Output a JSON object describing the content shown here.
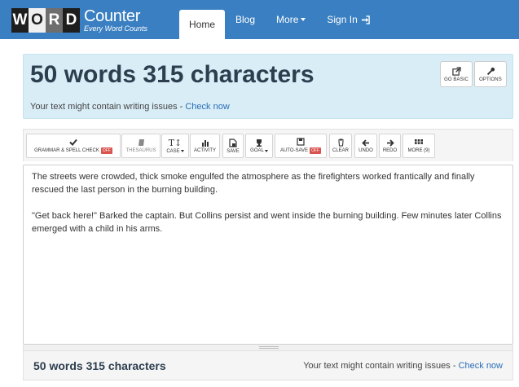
{
  "logo": {
    "letters": [
      "W",
      "O",
      "R",
      "D"
    ],
    "brand": "Counter",
    "tagline": "Every Word Counts"
  },
  "nav": {
    "items": [
      {
        "label": "Home",
        "active": true
      },
      {
        "label": "Blog"
      },
      {
        "label": "More"
      },
      {
        "label": "Sign In"
      }
    ]
  },
  "header": {
    "count_title": "50 words 315 characters",
    "hint_prefix": "Your text might contain writing issues - ",
    "hint_link": "Check now",
    "go_basic_label": "GO BASIC",
    "options_label": "OPTIONS"
  },
  "toolbar": {
    "grammar": "GRAMMAR & SPELL CHECK",
    "grammar_state": "OFF",
    "thesaurus": "THESAURUS",
    "case": "CASE",
    "activity": "ACTIVITY",
    "save": "SAVE",
    "goal": "GOAL",
    "autosave": "AUTO-SAVE",
    "autosave_state": "OFF",
    "clear": "CLEAR",
    "undo": "UNDO",
    "redo": "REDO",
    "more": "MORE (9)"
  },
  "editor": {
    "paragraphs": [
      "The streets were crowded, thick smoke engulfed the atmosphere as the firefighters worked frantically and finally rescued the last person in the burning building.",
      "\"Get back here!\" Barked the captain. But Collins persist and went inside the burning building. Few minutes later Collins emerged with a child in his arms."
    ]
  },
  "footer": {
    "count": "50 words 315 characters",
    "hint_prefix": "Your text might contain writing issues - ",
    "hint_link": "Check now"
  },
  "colors": {
    "navbar": "#3a7fc1",
    "panel": "#d9edf7",
    "link": "#2a6eb5",
    "off_badge": "#d9534f"
  }
}
